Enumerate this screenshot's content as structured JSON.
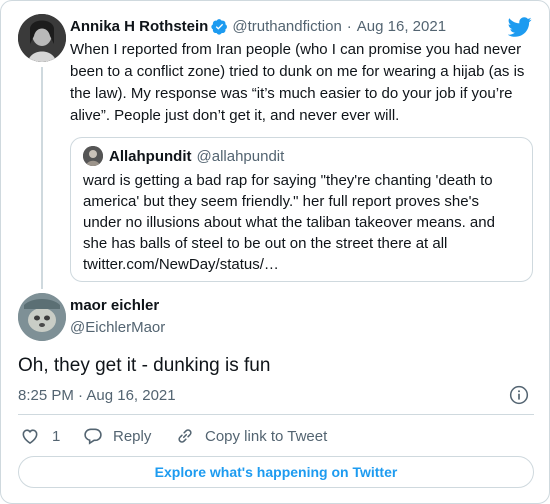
{
  "parent_tweet": {
    "author_name": "Annika H Rothstein",
    "handle": "@truthandfiction",
    "separator": "·",
    "date": "Aug 16, 2021",
    "text": "When I reported from Iran people (who I can promise you had never been to a conflict zone) tried to dunk on me for wearing a hijab (as is the law). My response was “it’s much easier to do your job if you’re alive”. People just don’t get it, and never ever will."
  },
  "quoted_tweet": {
    "author_name": "Allahpundit",
    "handle": "@allahpundit",
    "text": "ward is getting a bad rap for saying \"they're chanting 'death to america' but they seem friendly.\" her full report proves she's under no illusions about what the taliban takeover means. and she has balls of steel to be out on the street there at all",
    "link": "twitter.com/NewDay/status/…"
  },
  "reply_tweet": {
    "author_name": "maor eichler",
    "handle": "@EichlerMaor",
    "text": "Oh, they get it - dunking is fun",
    "timestamp": "8:25 PM · Aug 16, 2021"
  },
  "actions": {
    "like_count": "1",
    "reply_label": "Reply",
    "copy_link_label": "Copy link to Tweet"
  },
  "explore_button_label": "Explore what's happening on Twitter",
  "colors": {
    "twitter_blue": "#1d9bf0",
    "muted_text": "#536471",
    "border": "#cfd9de"
  },
  "icons": [
    "verified-badge-icon",
    "twitter-bird-icon",
    "info-icon",
    "heart-icon",
    "reply-bubble-icon",
    "link-icon"
  ]
}
